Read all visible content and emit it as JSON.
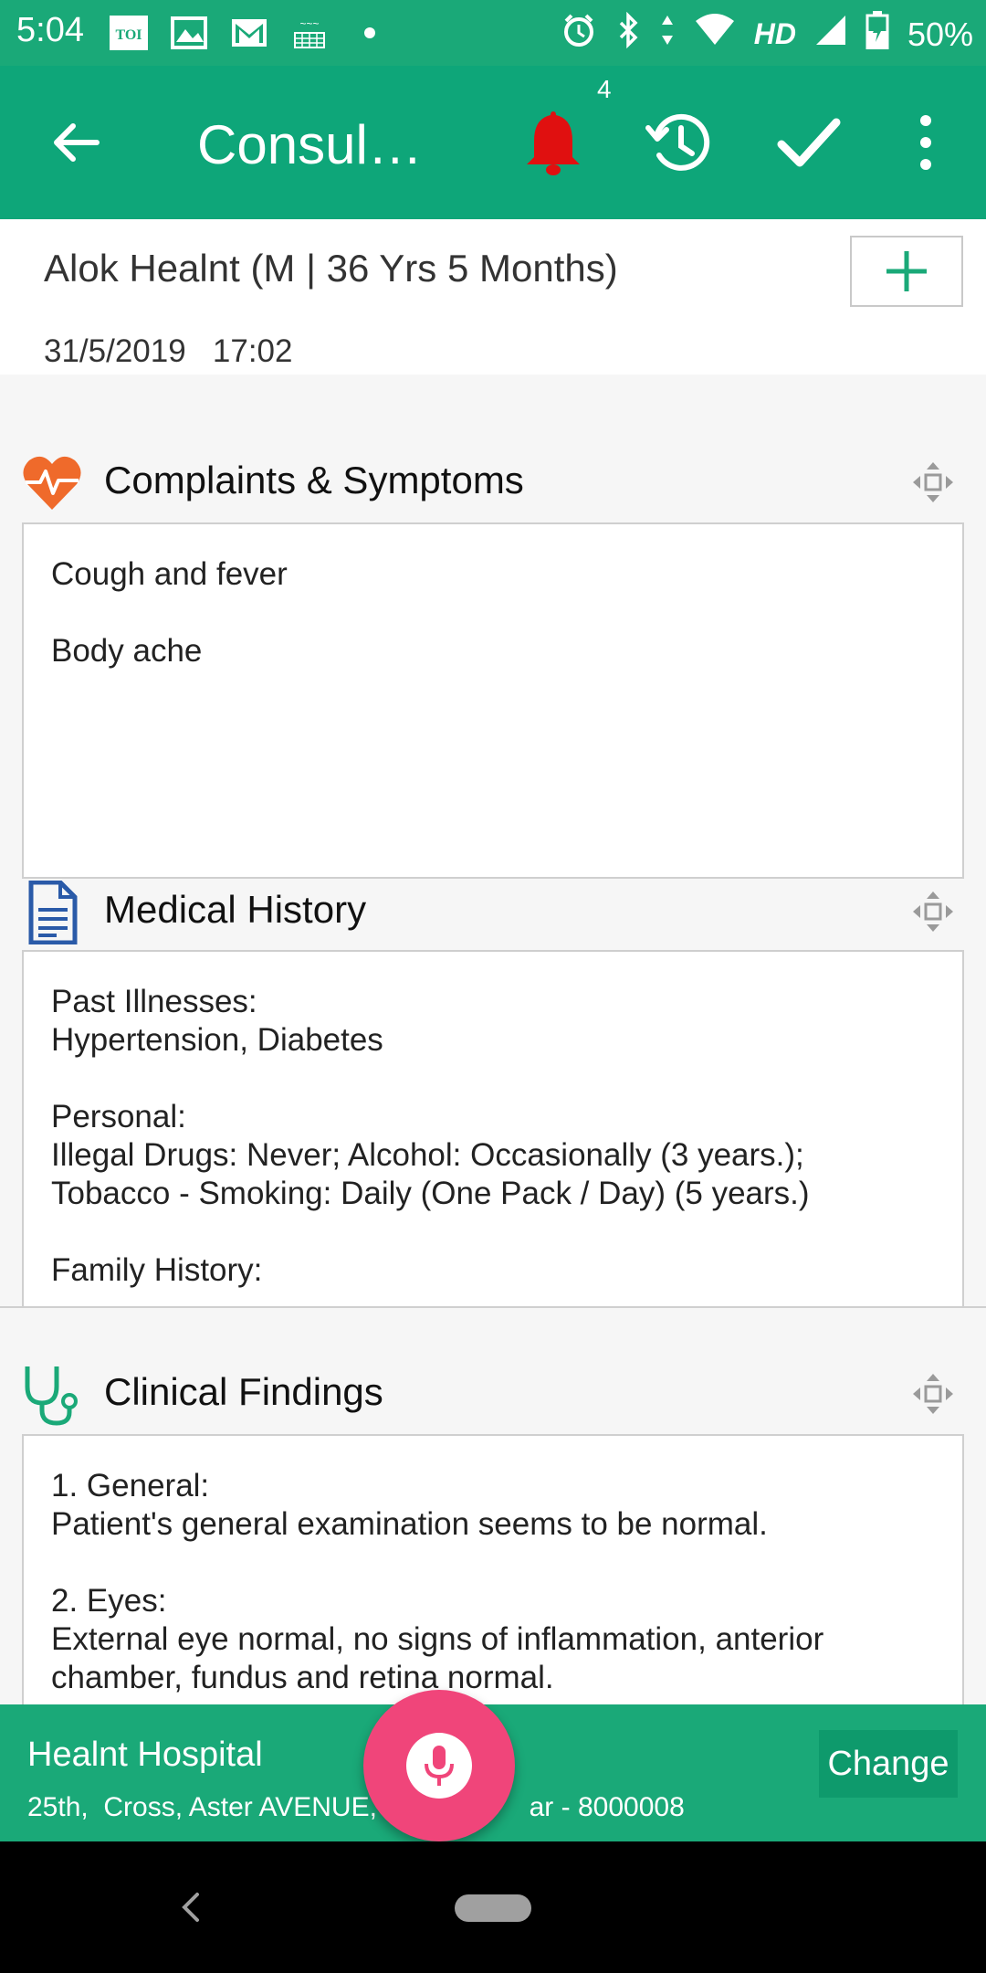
{
  "status_bar": {
    "time": "5:04",
    "notifications": [
      "toi-icon",
      "gallery-icon",
      "gmail-icon",
      "amazon-icon",
      "dot-icon"
    ],
    "network": "HD",
    "battery": "50%"
  },
  "toolbar": {
    "title": "Consul…",
    "notification_count": "4",
    "colors": {
      "bar": "#0ea679",
      "bell": "#e01010"
    }
  },
  "patient": {
    "name": "Alok Healnt (M | 36 Yrs 5 Months)",
    "date": "31/5/2019",
    "time": "17:02"
  },
  "sections": {
    "complaints": {
      "title": "Complaints & Symptoms",
      "text": "Cough and fever\n\nBody ache"
    },
    "history": {
      "title": "Medical History",
      "text": "Past Illnesses:\nHypertension, Diabetes\n\nPersonal:\nIllegal Drugs: Never; Alcohol: Occasionally (3 years.);\nTobacco - Smoking: Daily (One Pack / Day) (5 years.)\n\nFamily History:"
    },
    "clinical": {
      "title": "Clinical Findings",
      "text": "1. General:\nPatient's general examination seems to be normal.\n\n2. Eyes:\nExternal eye normal, no signs of inflammation, anterior\nchamber, fundus and retina normal."
    }
  },
  "hospital": {
    "name": "Healnt Hospital",
    "address": "25th,  Cross, Aster AVENUE,                    ar - 8000008",
    "change_label": "Change"
  }
}
